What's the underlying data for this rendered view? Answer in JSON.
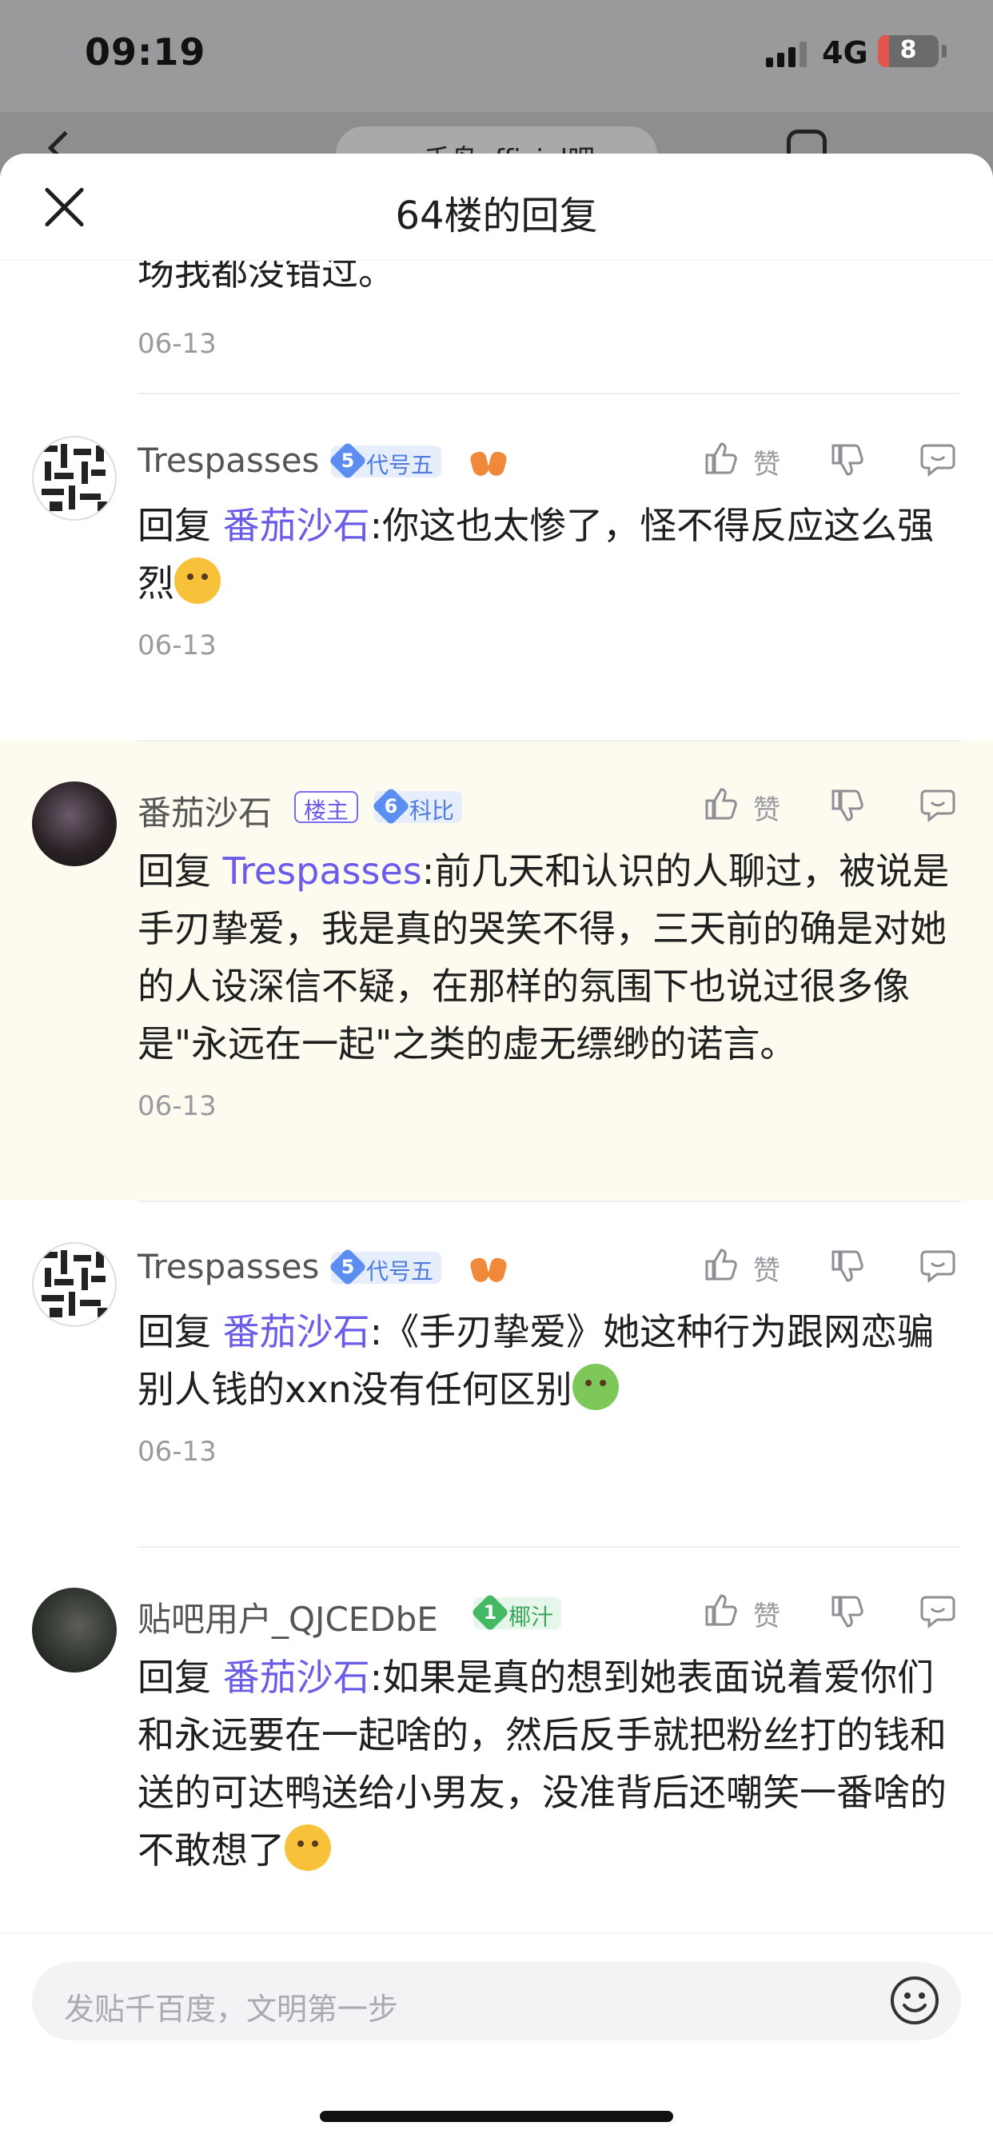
{
  "status_bar": {
    "time": "09:19",
    "network": "4G",
    "battery": "8"
  },
  "background_nav": {
    "forum_title": "千鸟official吧"
  },
  "sheet": {
    "title": "64楼的回复"
  },
  "partial_comment": {
    "text": "场我都没错过。",
    "date": "06-13"
  },
  "like_label": "赞",
  "comments": [
    {
      "username": "Trespasses",
      "level": "5",
      "badge": "代号五",
      "reply_prefix": "回复",
      "reply_to": "番茄沙石",
      "text": ":你这也太惨了，怪不得反应这么强烈",
      "emoji": "sad-sweat-emoji",
      "date": "06-13"
    },
    {
      "username": "番茄沙石",
      "host_tag": "楼主",
      "level": "6",
      "badge": "科比",
      "reply_prefix": "回复",
      "reply_to": "Trespasses",
      "text": ":前几天和认识的人聊过，被说是手刃挚爱，我是真的哭笑不得，三天前的确是对她的人设深信不疑，在那样的氛围下也说过很多像是\"永远在一起\"之类的虚无缥缈的诺言。",
      "date": "06-13"
    },
    {
      "username": "Trespasses",
      "level": "5",
      "badge": "代号五",
      "reply_prefix": "回复",
      "reply_to": "番茄沙石",
      "text": ":《手刃挚爱》她这种行为跟网恋骗别人钱的xxn没有任何区别",
      "emoji": "nauseated-emoji",
      "date": "06-13"
    },
    {
      "username": "贴吧用户_QJCEDbE",
      "level": "1",
      "badge": "椰汁",
      "reply_prefix": "回复",
      "reply_to": "番茄沙石",
      "text": ":如果是真的想到她表面说着爱你们和永远要在一起啥的，然后反手就把粉丝打的钱和送的可达鸭送给小男友，没准背后还嘲笑一番啥的不敢想了",
      "emoji": "screaming-emoji"
    }
  ],
  "bottom_bar": {
    "placeholder": "发贴千百度，文明第一步"
  }
}
